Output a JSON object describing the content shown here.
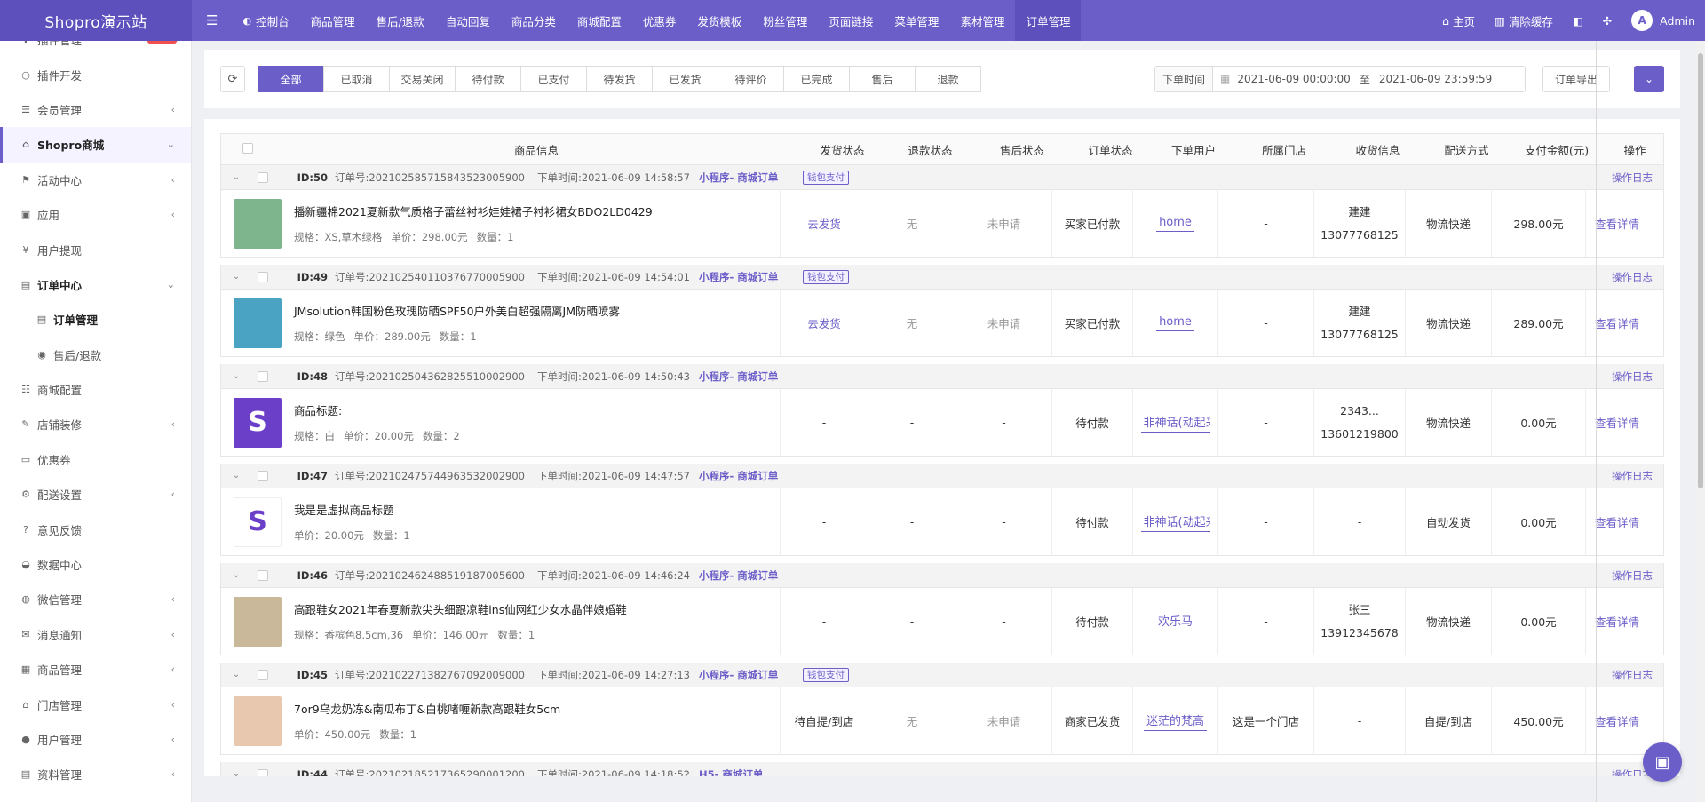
{
  "app": {
    "logo": "Shopro演示站"
  },
  "topnav": [
    {
      "label": "控制台",
      "icon": "dashboard-icon",
      "ico": "◐"
    },
    {
      "label": "商品管理"
    },
    {
      "label": "售后/退款"
    },
    {
      "label": "自动回复"
    },
    {
      "label": "商品分类"
    },
    {
      "label": "商城配置"
    },
    {
      "label": "优惠券"
    },
    {
      "label": "发货模板"
    },
    {
      "label": "粉丝管理"
    },
    {
      "label": "页面链接"
    },
    {
      "label": "菜单管理"
    },
    {
      "label": "素材管理"
    },
    {
      "label": "订单管理"
    }
  ],
  "topright": {
    "home": "主页",
    "clear_cache": "清除缓存",
    "user": "Admin",
    "avatar_letter": "A"
  },
  "sidebar": [
    {
      "label": "插件管理",
      "icon": "plugin-icon",
      "ico": "✚",
      "badge": "new"
    },
    {
      "label": "插件开发",
      "icon": "circle-icon",
      "ico": "○"
    },
    {
      "label": "会员管理",
      "icon": "list-icon",
      "ico": "☰",
      "arrow": "‹"
    },
    {
      "label": "Shopro商城",
      "icon": "home-icon",
      "ico": "⌂",
      "arrow": "⌄"
    },
    {
      "label": "活动中心",
      "icon": "flag-icon",
      "ico": "⚑",
      "arrow": "‹"
    },
    {
      "label": "应用",
      "icon": "briefcase-icon",
      "ico": "▣",
      "arrow": "‹"
    },
    {
      "label": "用户提现",
      "icon": "yen-icon",
      "ico": "¥"
    },
    {
      "label": "订单中心",
      "icon": "file-icon",
      "ico": "▤",
      "arrow": "⌄"
    },
    {
      "label": "订单管理",
      "icon": "file-icon",
      "ico": "▤"
    },
    {
      "label": "售后/退款",
      "icon": "eye-icon",
      "ico": "◉"
    },
    {
      "label": "商城配置",
      "icon": "sliders-icon",
      "ico": "☷"
    },
    {
      "label": "店铺装修",
      "icon": "brush-icon",
      "ico": "✎",
      "arrow": "‹"
    },
    {
      "label": "优惠券",
      "icon": "ticket-icon",
      "ico": "▭"
    },
    {
      "label": "配送设置",
      "icon": "gears-icon",
      "ico": "⚙",
      "arrow": "‹"
    },
    {
      "label": "意见反馈",
      "icon": "question-icon",
      "ico": "?"
    },
    {
      "label": "数据中心",
      "icon": "dashboard-icon",
      "ico": "◒"
    },
    {
      "label": "微信管理",
      "icon": "wechat-icon",
      "ico": "◍",
      "arrow": "‹"
    },
    {
      "label": "消息通知",
      "icon": "bullhorn-icon",
      "ico": "✉",
      "arrow": "‹"
    },
    {
      "label": "商品管理",
      "icon": "table-icon",
      "ico": "▦",
      "arrow": "‹"
    },
    {
      "label": "门店管理",
      "icon": "bank-icon",
      "ico": "⌂",
      "arrow": "‹"
    },
    {
      "label": "用户管理",
      "icon": "user-icon",
      "ico": "●",
      "arrow": "‹"
    },
    {
      "label": "资料管理",
      "icon": "document-icon",
      "ico": "▤",
      "arrow": "‹"
    }
  ],
  "filters": {
    "tabs": [
      "全部",
      "已取消",
      "交易关闭",
      "待付款",
      "已支付",
      "待发货",
      "已发货",
      "待评价",
      "已完成",
      "售后",
      "退款"
    ],
    "date_label": "下单时间",
    "date_from": "2021-06-09 00:00:00",
    "date_sep": "至",
    "date_to": "2021-06-09 23:59:59",
    "export": "订单导出"
  },
  "table": {
    "headers": [
      "商品信息",
      "发货状态",
      "退款状态",
      "售后状态",
      "订单状态",
      "下单用户",
      "所属门店",
      "收货信息",
      "配送方式",
      "支付金额(元)",
      "操作"
    ],
    "orders": [
      {
        "id": "ID:50",
        "order_no": "订单号:202102585715843523005900",
        "time": "下单时间:2021-06-09 14:58:57",
        "source": "小程序- 商城订单",
        "wallet": "钱包支付",
        "oplog": "操作日志",
        "title": "播新疆棉2021夏新款气质格子蕾丝衬衫娃娃裙子衬衫裙女BDO2LD0429",
        "spec": "规格：XS,草木绿格",
        "price": "单价：298.00元",
        "qty": "数量：1",
        "ship": "去发货",
        "refund": "无",
        "after": "未申请",
        "ostatus": "买家已付款",
        "user": "home",
        "store": "-",
        "recv_name": "建建",
        "recv_phone": "13077768125",
        "delivery": "物流快递",
        "amount": "298.00元",
        "detail": "查看详情",
        "thumb_color": "#7fb58c"
      },
      {
        "id": "ID:49",
        "order_no": "订单号:202102540110376770005900",
        "time": "下单时间:2021-06-09 14:54:01",
        "source": "小程序- 商城订单",
        "wallet": "钱包支付",
        "oplog": "操作日志",
        "title": "JMsolution韩国粉色玫瑰防晒SPF50户外美白超强隔离JM防晒喷雾",
        "spec": "规格：绿色",
        "price": "单价：289.00元",
        "qty": "数量：1",
        "ship": "去发货",
        "refund": "无",
        "after": "未申请",
        "ostatus": "买家已付款",
        "user": "home",
        "store": "-",
        "recv_name": "建建",
        "recv_phone": "13077768125",
        "delivery": "物流快递",
        "amount": "289.00元",
        "detail": "查看详情",
        "thumb_color": "#4aa3c2"
      },
      {
        "id": "ID:48",
        "order_no": "订单号:202102504362825510002900",
        "time": "下单时间:2021-06-09 14:50:43",
        "source": "小程序- 商城订单",
        "wallet": "",
        "oplog": "操作日志",
        "title": "商品标题:",
        "spec": "规格：白",
        "price": "单价：20.00元",
        "qty": "数量：2",
        "ship": "-",
        "refund": "-",
        "after": "-",
        "ostatus": "待付款",
        "user": "非神话(动起来",
        "store": "-",
        "recv_name": "2343...",
        "recv_phone": "13601219800",
        "delivery": "物流快递",
        "amount": "0.00元",
        "detail": "查看详情",
        "thumb_color": "#6b3fc8"
      },
      {
        "id": "ID:47",
        "order_no": "订单号:202102475744963532002900",
        "time": "下单时间:2021-06-09 14:47:57",
        "source": "小程序- 商城订单",
        "wallet": "",
        "oplog": "操作日志",
        "title": "我是是虚拟商品标题",
        "spec": "",
        "price": "单价：20.00元",
        "qty": "数量：1",
        "ship": "-",
        "refund": "-",
        "after": "-",
        "ostatus": "待付款",
        "user": "非神话(动起来",
        "store": "-",
        "recv_name": "-",
        "recv_phone": "",
        "delivery": "自动发货",
        "amount": "0.00元",
        "detail": "查看详情",
        "thumb_color": "#ffffff"
      },
      {
        "id": "ID:46",
        "order_no": "订单号:202102462488519187005600",
        "time": "下单时间:2021-06-09 14:46:24",
        "source": "小程序- 商城订单",
        "wallet": "",
        "oplog": "操作日志",
        "title": "高跟鞋女2021年春夏新款尖头细跟凉鞋ins仙网红少女水晶伴娘婚鞋",
        "spec": "规格：香槟色8.5cm,36",
        "price": "单价：146.00元",
        "qty": "数量：1",
        "ship": "-",
        "refund": "-",
        "after": "-",
        "ostatus": "待付款",
        "user": "欢乐马",
        "store": "-",
        "recv_name": "张三",
        "recv_phone": "13912345678",
        "delivery": "物流快递",
        "amount": "0.00元",
        "detail": "查看详情",
        "thumb_color": "#c9b89a"
      },
      {
        "id": "ID:45",
        "order_no": "订单号:202102271382767092009000",
        "time": "下单时间:2021-06-09 14:27:13",
        "source": "小程序- 商城订单",
        "wallet": "钱包支付",
        "oplog": "操作日志",
        "title": "7or9乌龙奶冻&南瓜布丁&白桃啫喱新款高跟鞋女5cm",
        "spec": "",
        "price": "单价：450.00元",
        "qty": "数量：1",
        "ship": "待自提/到店",
        "refund": "无",
        "after": "未申请",
        "ostatus": "商家已发货",
        "user": "迷茫的梵高",
        "store": "这是一个门店",
        "recv_name": "-",
        "recv_phone": "",
        "delivery": "自提/到店",
        "amount": "450.00元",
        "detail": "查看详情",
        "thumb_color": "#e8c9b0"
      },
      {
        "id": "ID:44",
        "order_no": "订单号:202102185217365290001200",
        "time": "下单时间:2021-06-09 14:18:52",
        "source": "H5- 商城订单",
        "wallet": "",
        "oplog": "操作日志"
      }
    ]
  },
  "colors": {
    "accent": "#6b5ec9"
  }
}
